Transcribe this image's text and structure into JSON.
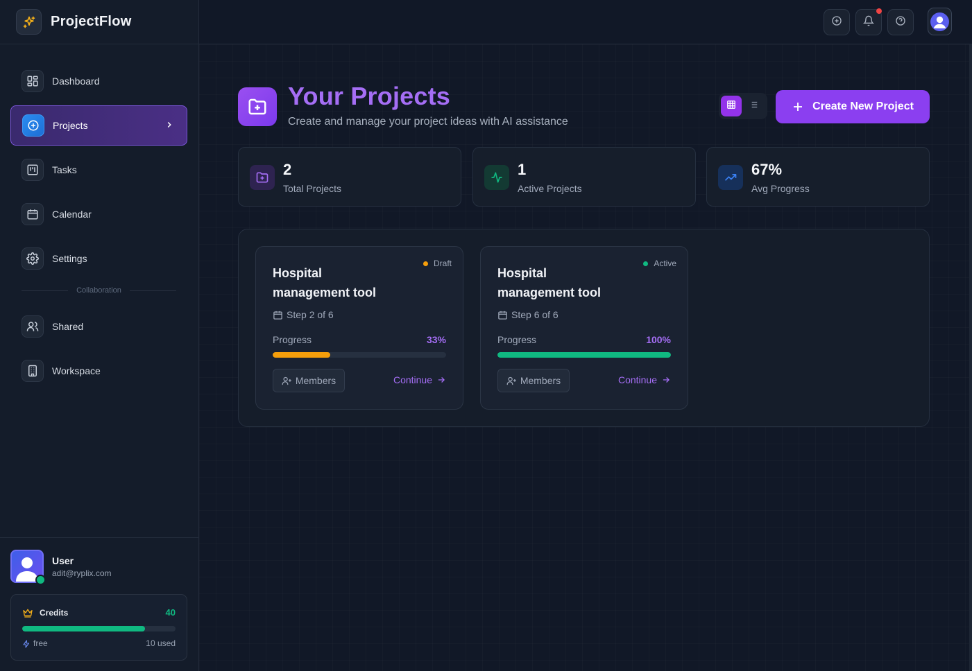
{
  "app": {
    "name": "ProjectFlow"
  },
  "sidebar": {
    "items": [
      {
        "label": "Dashboard"
      },
      {
        "label": "Projects"
      },
      {
        "label": "Tasks"
      },
      {
        "label": "Calendar"
      },
      {
        "label": "Settings"
      }
    ],
    "section_label": "Collaboration",
    "collab_items": [
      {
        "label": "Shared"
      },
      {
        "label": "Workspace"
      }
    ]
  },
  "user": {
    "name": "User",
    "email": "adit@ryplix.com"
  },
  "credits": {
    "title": "Credits",
    "count": "40",
    "plan": "free",
    "used": "10 used",
    "fill_fraction": 0.8
  },
  "header": {
    "title": "Your Projects",
    "subtitle": "Create and manage your project ideas with AI assistance",
    "create_label": "Create New Project"
  },
  "stats": [
    {
      "value": "2",
      "label": "Total Projects"
    },
    {
      "value": "1",
      "label": "Active Projects"
    },
    {
      "value": "67%",
      "label": "Avg Progress"
    }
  ],
  "projects": [
    {
      "title": "Hospital management tool",
      "status": "Draft",
      "status_color": "#f59e0b",
      "step": "Step 2 of 6",
      "progress_label": "Progress",
      "progress_pct": "33%",
      "progress": 0.33,
      "bar_color": "#f59e0b",
      "members_label": "Members",
      "continue_label": "Continue"
    },
    {
      "title": "Hospital management tool",
      "status": "Active",
      "status_color": "#10b981",
      "step": "Step 6 of 6",
      "progress_label": "Progress",
      "progress_pct": "100%",
      "progress": 1.0,
      "bar_color": "#10b981",
      "members_label": "Members",
      "continue_label": "Continue"
    }
  ],
  "colors": {
    "accent": "#8b3ff0",
    "success": "#10b981",
    "warning": "#f59e0b"
  }
}
